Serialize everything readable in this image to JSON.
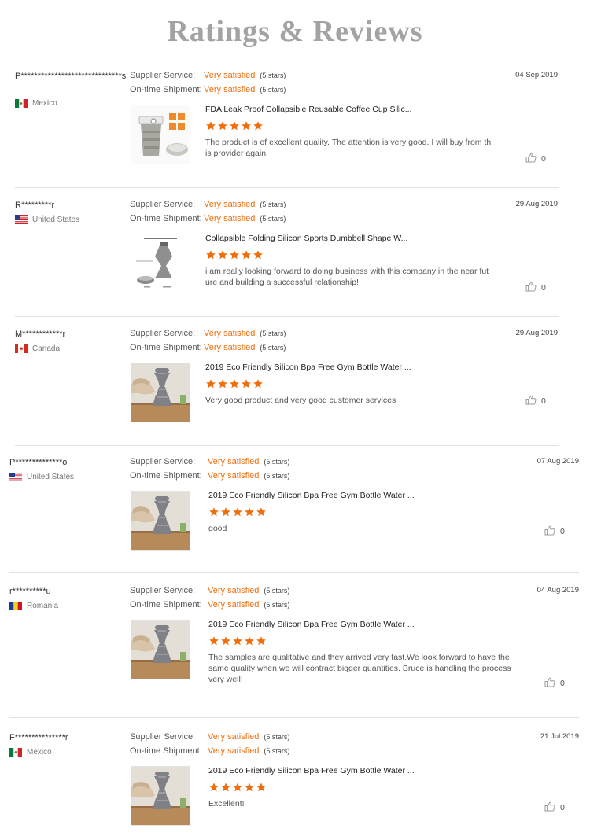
{
  "page": {
    "heading": "Ratings & Reviews"
  },
  "labels": {
    "supplier_service": "Supplier Service:",
    "ontime_shipment": "On-time Shipment:"
  },
  "colors": {
    "accent": "#f06d0a",
    "heading": "#a3a3a3",
    "divider": "#e2e2e2"
  },
  "reviews": [
    {
      "reviewer": "P******************************s",
      "country": "Mexico",
      "flag": "mexico-flag-icon",
      "supplier_rating": "Very satisfied",
      "supplier_stars": "(5 stars)",
      "shipment_rating": "Very satisfied",
      "shipment_stars": "(5 stars)",
      "date": "04 Sep 2019",
      "product_title": "FDA Leak Proof Collapsible Reusable Coffee Cup Silic...",
      "stars": 5,
      "comment": "The product is of excellent quality. The attention is very good. I will buy from th is provider again.",
      "likes": "0"
    },
    {
      "reviewer": "R*********r",
      "country": "United States",
      "flag": "usa-flag-icon",
      "supplier_rating": "Very satisfied",
      "supplier_stars": "(5 stars)",
      "shipment_rating": "Very satisfied",
      "shipment_stars": "(5 stars)",
      "date": "29 Aug 2019",
      "product_title": "Collapsible Folding Silicon Sports Dumbbell Shape W...",
      "stars": 5,
      "comment": "i am really looking forward to doing business with this company in the near fut ure and building a successful relationship!",
      "likes": "0"
    },
    {
      "reviewer": "M************r",
      "country": "Canada",
      "flag": "canada-flag-icon",
      "supplier_rating": "Very satisfied",
      "supplier_stars": "(5 stars)",
      "shipment_rating": "Very satisfied",
      "shipment_stars": "(5 stars)",
      "date": "29 Aug 2019",
      "product_title": "2019 Eco Friendly Silicon Bpa Free Gym Bottle Water ...",
      "stars": 5,
      "comment": "Very good product and very good customer services",
      "likes": "0"
    },
    {
      "reviewer": "P**************o",
      "country": "United States",
      "flag": "usa-flag-icon",
      "supplier_rating": "Very satisfied",
      "supplier_stars": "(5 stars)",
      "shipment_rating": "Very satisfied",
      "shipment_stars": "(5 stars)",
      "date": "07 Aug 2019",
      "product_title": "2019 Eco Friendly Silicon Bpa Free Gym Bottle Water ...",
      "stars": 5,
      "comment": "good",
      "likes": "0"
    },
    {
      "reviewer": "r**********u",
      "country": "Romania",
      "flag": "romania-flag-icon",
      "supplier_rating": "Very satisfied",
      "supplier_stars": "(5 stars)",
      "shipment_rating": "Very satisfied",
      "shipment_stars": "(5 stars)",
      "date": "04 Aug 2019",
      "product_title": "2019 Eco Friendly Silicon Bpa Free Gym Bottle Water ...",
      "stars": 5,
      "comment": "The samples are qualitative and they arrived very fast.We look forward to have the same quality when we will contract bigger quantities. Bruce is handling the process very well!",
      "likes": "0"
    },
    {
      "reviewer": "F***************r",
      "country": "Mexico",
      "flag": "mexico-flag-icon",
      "supplier_rating": "Very satisfied",
      "supplier_stars": "(5 stars)",
      "shipment_rating": "Very satisfied",
      "shipment_stars": "(5 stars)",
      "date": "21 Jul 2019",
      "product_title": "2019 Eco Friendly Silicon Bpa Free Gym Bottle Water ...",
      "stars": 5,
      "comment": "Excellent!",
      "likes": "0"
    }
  ]
}
